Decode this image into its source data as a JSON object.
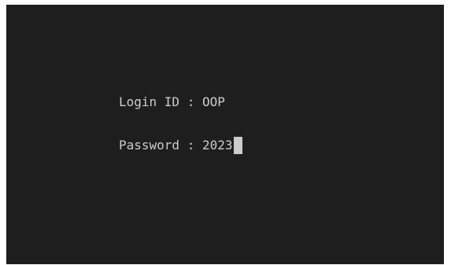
{
  "terminal": {
    "background": "#1e1e1e",
    "text_color": "#cccccc",
    "cursor_color": "#cccccc",
    "lines": {
      "login": {
        "label": "Login ID",
        "separator": " : ",
        "value": "OOP"
      },
      "password": {
        "label": "Password",
        "separator": " : ",
        "value": "2023"
      }
    }
  }
}
